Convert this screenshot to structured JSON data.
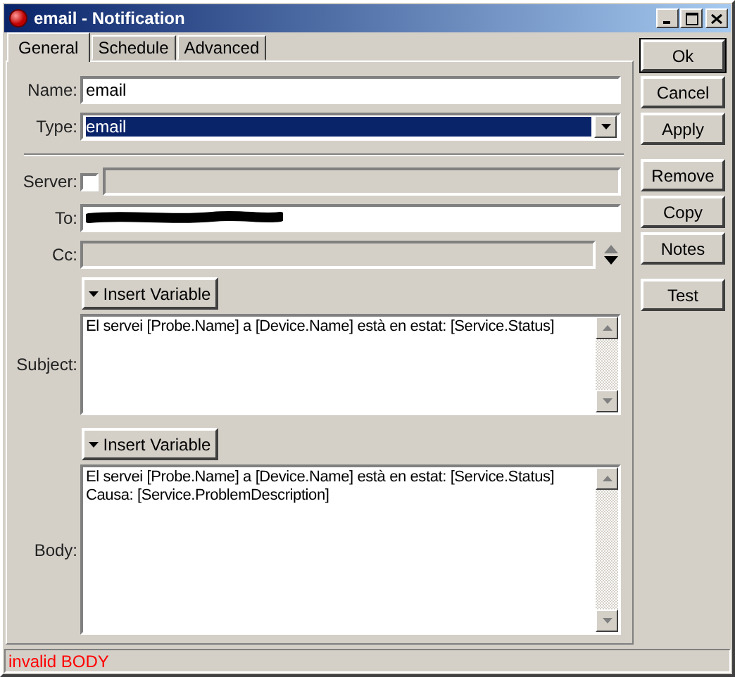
{
  "window": {
    "title": "email - Notification"
  },
  "tabs": [
    {
      "label": "General",
      "selected": true
    },
    {
      "label": "Schedule",
      "selected": false
    },
    {
      "label": "Advanced",
      "selected": false
    }
  ],
  "form": {
    "name": {
      "label": "Name:",
      "value": "email"
    },
    "type": {
      "label": "Type:",
      "value": "email",
      "highlighted": true
    },
    "server": {
      "label": "Server:",
      "checked": false,
      "disabled": true
    },
    "to": {
      "label": "To:",
      "redacted": true
    },
    "cc": {
      "label": "Cc:",
      "disabled": true
    },
    "subject": {
      "label": "Subject:",
      "button": "Insert Variable",
      "lines": [
        "El servei [Probe.Name] a [Device.Name] està en estat: [Service.Status]"
      ]
    },
    "body": {
      "label": "Body:",
      "button": "Insert Variable",
      "lines": [
        "El servei [Probe.Name] a [Device.Name] està en estat: [Service.Status]",
        "Causa: [Service.ProblemDescription]"
      ]
    }
  },
  "button_groups": [
    {
      "buttons": [
        {
          "label": "Ok",
          "default": true
        },
        {
          "label": "Cancel",
          "default": false
        },
        {
          "label": "Apply",
          "default": false
        }
      ]
    },
    {
      "buttons": [
        {
          "label": "Remove",
          "default": false
        },
        {
          "label": "Copy",
          "default": false
        },
        {
          "label": "Notes",
          "default": false
        }
      ]
    },
    {
      "buttons": [
        {
          "label": "Test",
          "default": false
        }
      ]
    }
  ],
  "status_bar": {
    "message": "invalid BODY",
    "kind": "error"
  }
}
